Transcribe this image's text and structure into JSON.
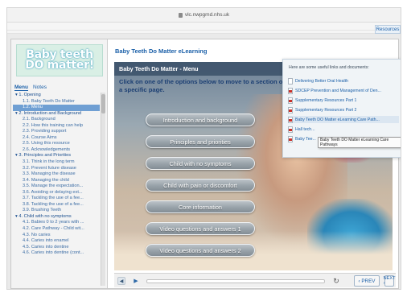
{
  "browser": {
    "url": "vlc.nwpgmd.nhs.uk"
  },
  "sidebar": {
    "logo_line1": "Baby teeth",
    "logo_line2": "DO matter!",
    "tabs": [
      "Menu",
      "Notes"
    ],
    "items": [
      {
        "label": "▾ 1. Opening"
      },
      {
        "label": "1.1. Baby Teeth Do Matter"
      },
      {
        "label": "1.2. Menu"
      },
      {
        "label": "▾ 2. Introduction and Background"
      },
      {
        "label": "2.1. Background"
      },
      {
        "label": "2.2. How this training can help"
      },
      {
        "label": "2.3. Providing support"
      },
      {
        "label": "2.4. Course Aims"
      },
      {
        "label": "2.5. Using this resource"
      },
      {
        "label": "2.6. Acknowledgements"
      },
      {
        "label": "▾ 3. Principles and Priorities"
      },
      {
        "label": "3.1. Think in the long term"
      },
      {
        "label": "3.2. Prevent future disease"
      },
      {
        "label": "3.3. Managing the disease"
      },
      {
        "label": "3.4. Managing the child"
      },
      {
        "label": "3.5. Manage the expectation..."
      },
      {
        "label": "3.6. Avoiding or delaying ext..."
      },
      {
        "label": "3.7. Tackling the use of a fee..."
      },
      {
        "label": "3.8. Tackling the use of a fee..."
      },
      {
        "label": "3.9. Brushing Teeth"
      },
      {
        "label": "▾ 4. Child with no symptoms"
      },
      {
        "label": "4.1. Babies 0 to 2 years with ..."
      },
      {
        "label": "4.2. Care Pathway - Child wit..."
      },
      {
        "label": "4.3. No caries"
      },
      {
        "label": "4.4. Caries into enamel"
      },
      {
        "label": "4.5. Caries into dentine"
      },
      {
        "label": "4.6. Caries into dentine (cont..."
      }
    ]
  },
  "main": {
    "title": "Baby Teeth Do Matter eLearning",
    "menu_header": "Baby Teeth Do Matter - Menu",
    "intro": "Click on one of the options below to move to a section or to go to a specific page.",
    "buttons": [
      "Introduction and background",
      "Principles and priorities",
      "Child with no symptoms",
      "Child with pain or discomfort",
      "Core information",
      "Video questions and answers 1",
      "Video questions and answers 2"
    ]
  },
  "resources": {
    "button": "Resources",
    "header": "Here are some useful links and documents:",
    "items": [
      "Delivering Better Oral Health",
      "SDCEP Prevention and Management of Den...",
      "Supplementary Resources Part 1",
      "Supplementary Resources Part 2",
      "Baby Teeth DO Matter eLearning Care Path...",
      "Hall tech...",
      "Baby Tee..."
    ],
    "tooltip": "Baby Teeth DO Matter eLearning Care Pathways"
  },
  "player": {
    "prev": "‹ PREV",
    "next": "NEXT ›",
    "volume_icon": "speaker-icon",
    "play_icon": "play-icon",
    "reload_icon": "reload-icon"
  }
}
